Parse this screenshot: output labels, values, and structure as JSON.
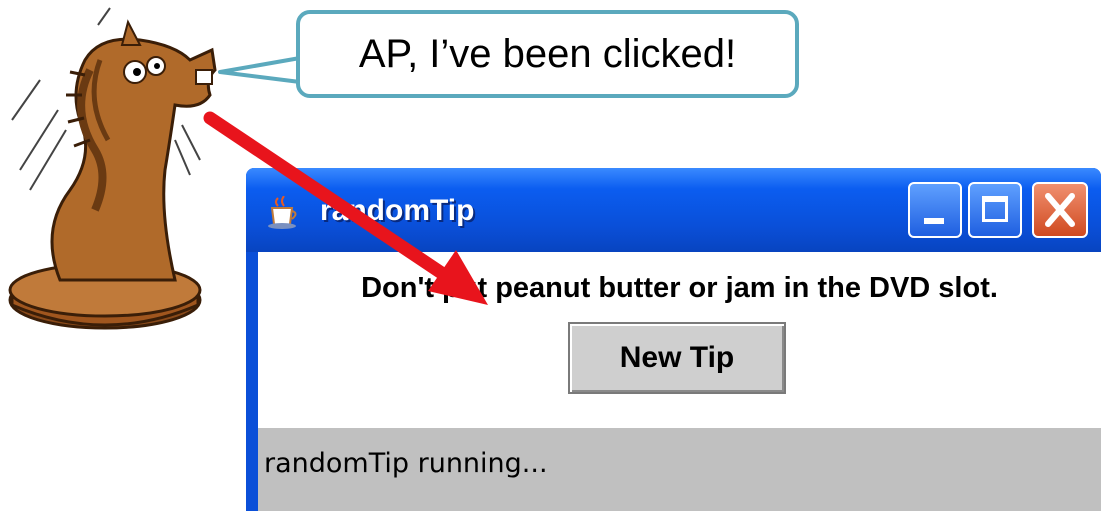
{
  "callout": {
    "text": "AP, I’ve been clicked!"
  },
  "window": {
    "title": "randomTip",
    "icon": "java-cup-icon",
    "controls": [
      "minimize-icon",
      "maximize-icon",
      "close-icon"
    ]
  },
  "main": {
    "tip_text": "Don't put peanut butter or jam in the DVD slot.",
    "button_label": "New Tip"
  },
  "status": {
    "text": "randomTip running..."
  },
  "colors": {
    "title_bar": "#0a4fd8",
    "close_button": "#d04a20",
    "bubble_border": "#5ba9bd",
    "arrow": "#e8141c",
    "status_bg": "#c0c0c0"
  }
}
